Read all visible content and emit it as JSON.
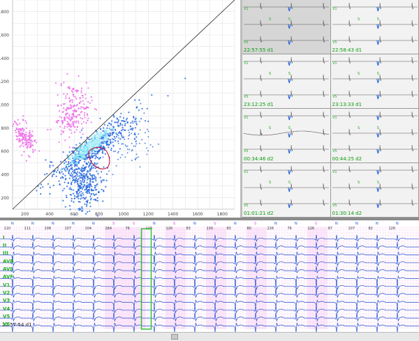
{
  "scatter": {
    "y_ticks": [
      "200",
      "400",
      "600",
      "800",
      "1000",
      "1200",
      "1400",
      "1600",
      "1800"
    ],
    "x_ticks": [
      "200",
      "400",
      "600",
      "800",
      "1000",
      "1200",
      "1400",
      "1600",
      "1800"
    ],
    "colors": {
      "normal": "#2f6fe0",
      "dense": "#7fe3f5",
      "ectopic": "#ef6fea",
      "lasso": "#c0143c",
      "grid": "#e3e3e3",
      "axis_line": "#222222"
    }
  },
  "beat_grid": {
    "cells": [
      {
        "time": "22:57:55 d1",
        "selected": true
      },
      {
        "time": "22:58:43 d1",
        "selected": false
      },
      {
        "time": "23:12:25 d1",
        "selected": false
      },
      {
        "time": "23:13:33 d1",
        "selected": false
      },
      {
        "time": "00:34:46 d2",
        "selected": false
      },
      {
        "time": "00:44:25 d2",
        "selected": false
      },
      {
        "time": "01:01:21 d2",
        "selected": false
      },
      {
        "time": "01:30:14 d2",
        "selected": false
      }
    ],
    "row_lead_labels": [
      "V1",
      "V5"
    ],
    "beat_marker": "S",
    "colors": {
      "trace": "#555555",
      "beat_blue": "#1a5be0",
      "marker": "#22aa22"
    }
  },
  "ecg": {
    "rr_labels": [
      "110",
      "111",
      "108",
      "107",
      "104",
      "284",
      "76",
      "126",
      "126",
      "83",
      "130",
      "83",
      "80",
      "226",
      "76",
      "126",
      "97",
      "107",
      "82",
      "126"
    ],
    "beat_types": [
      "N",
      "N",
      "N",
      "N",
      "N",
      "S",
      "S",
      "N",
      "S",
      "N",
      "S",
      "N",
      "S",
      "N",
      "N",
      "S",
      "N",
      "N",
      "N",
      "N"
    ],
    "leads": [
      "I",
      "II",
      "III",
      "AVR",
      "AVL",
      "AVF",
      "V1",
      "V2",
      "V3",
      "V4",
      "V5",
      "V6"
    ],
    "start_time": "22:57:54 d1",
    "colors": {
      "normal": "#1f4fd0",
      "ectopic": "#e13fd6",
      "grid": "#f3c8ef",
      "selection": "#27c227",
      "label": "#22b022"
    }
  }
}
